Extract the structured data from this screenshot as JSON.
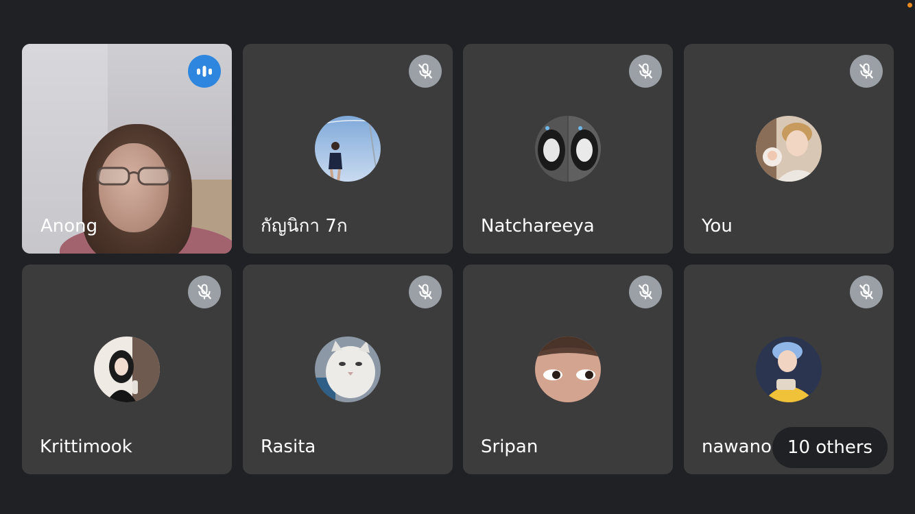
{
  "participants": [
    {
      "name": "Anong",
      "status_icon": "speaking-icon"
    },
    {
      "name": "กัญนิกา 7ก",
      "status_icon": "mic-off-icon"
    },
    {
      "name": "Natchareeya",
      "status_icon": "mic-off-icon"
    },
    {
      "name": "You",
      "status_icon": "mic-off-icon"
    },
    {
      "name": "Krittimook",
      "status_icon": "mic-off-icon"
    },
    {
      "name": "Rasita",
      "status_icon": "mic-off-icon"
    },
    {
      "name": "Sripan",
      "status_icon": "mic-off-icon"
    },
    {
      "name": "nawano",
      "status_icon": "mic-off-icon"
    }
  ],
  "others_label": "10 others",
  "colors": {
    "background": "#202124",
    "tile": "#3c3c3d",
    "speaking": "#2f86de",
    "muted_badge": "#9aa0a6",
    "status_dot": "#e8891d"
  }
}
